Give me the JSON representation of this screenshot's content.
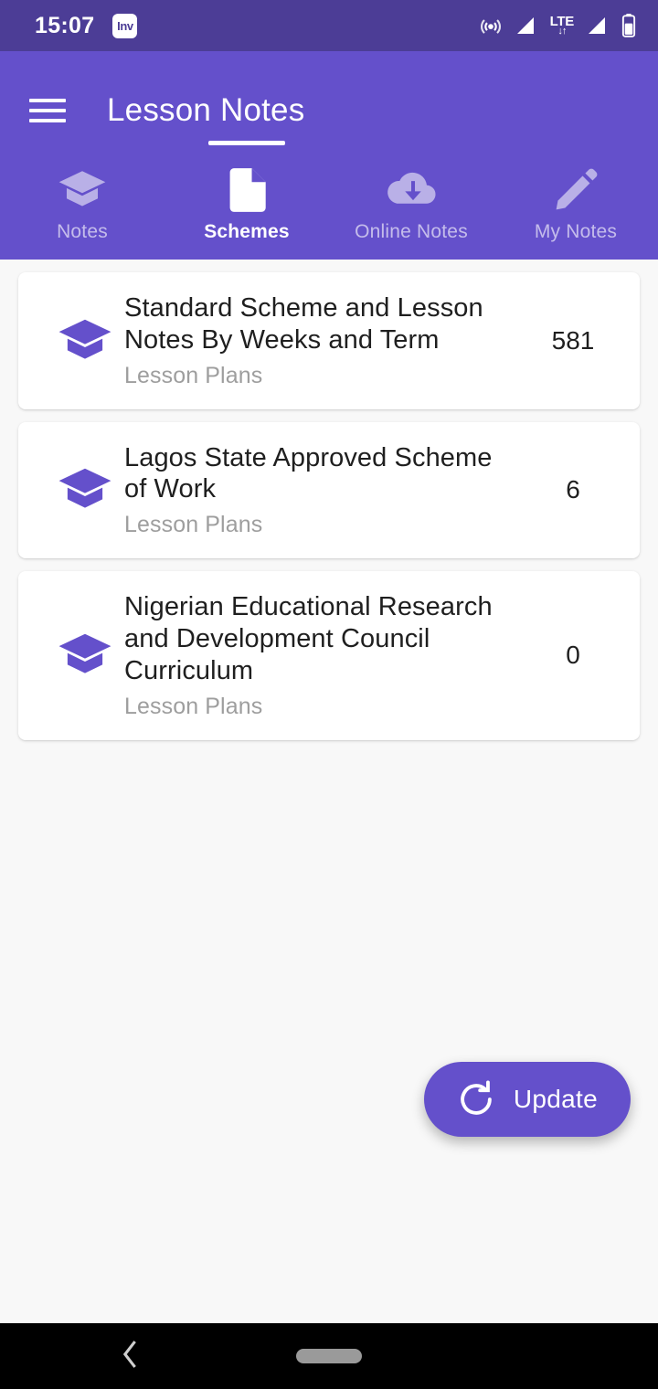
{
  "statusbar": {
    "time": "15:07",
    "app_badge": "Inv",
    "icons": [
      "hotspot-icon",
      "signal-icon",
      "lte-icon",
      "signal-icon-2",
      "battery-icon"
    ],
    "network_label": "LTE",
    "data_arrows": "↓↑",
    "background": "#4C3D96"
  },
  "appbar": {
    "menu_icon": "hamburger-menu-icon",
    "title": "Lesson Notes",
    "background": "#6450CB"
  },
  "tabs": {
    "active_index": 1,
    "items": [
      {
        "label": "Notes",
        "icon": "graduation-cap-icon"
      },
      {
        "label": "Schemes",
        "icon": "document-icon"
      },
      {
        "label": "Online Notes",
        "icon": "cloud-download-icon"
      },
      {
        "label": "My Notes",
        "icon": "pencil-icon"
      }
    ]
  },
  "list": {
    "items": [
      {
        "icon": "graduation-cap-icon",
        "title": "Standard Scheme and Lesson Notes By Weeks and Term",
        "subtitle": "Lesson Plans",
        "count": "581"
      },
      {
        "icon": "graduation-cap-icon",
        "title": "Lagos State Approved Scheme of Work",
        "subtitle": "Lesson Plans",
        "count": "6"
      },
      {
        "icon": "graduation-cap-icon",
        "title": "Nigerian Educational Research and Development Council Curriculum",
        "subtitle": "Lesson Plans",
        "count": "0"
      }
    ]
  },
  "fab": {
    "label": "Update",
    "icon": "refresh-icon",
    "background": "#6450CB"
  },
  "navbar": {
    "back_icon": "back-chevron-icon",
    "home_pill": "home-pill-handle"
  },
  "colors": {
    "primary": "#6450CB",
    "status_bar": "#4C3D96",
    "page_background": "#F8F8F8",
    "card_background": "#FFFFFF",
    "title_text": "#1F1F1F",
    "subtitle_text": "#9E9E9E"
  }
}
